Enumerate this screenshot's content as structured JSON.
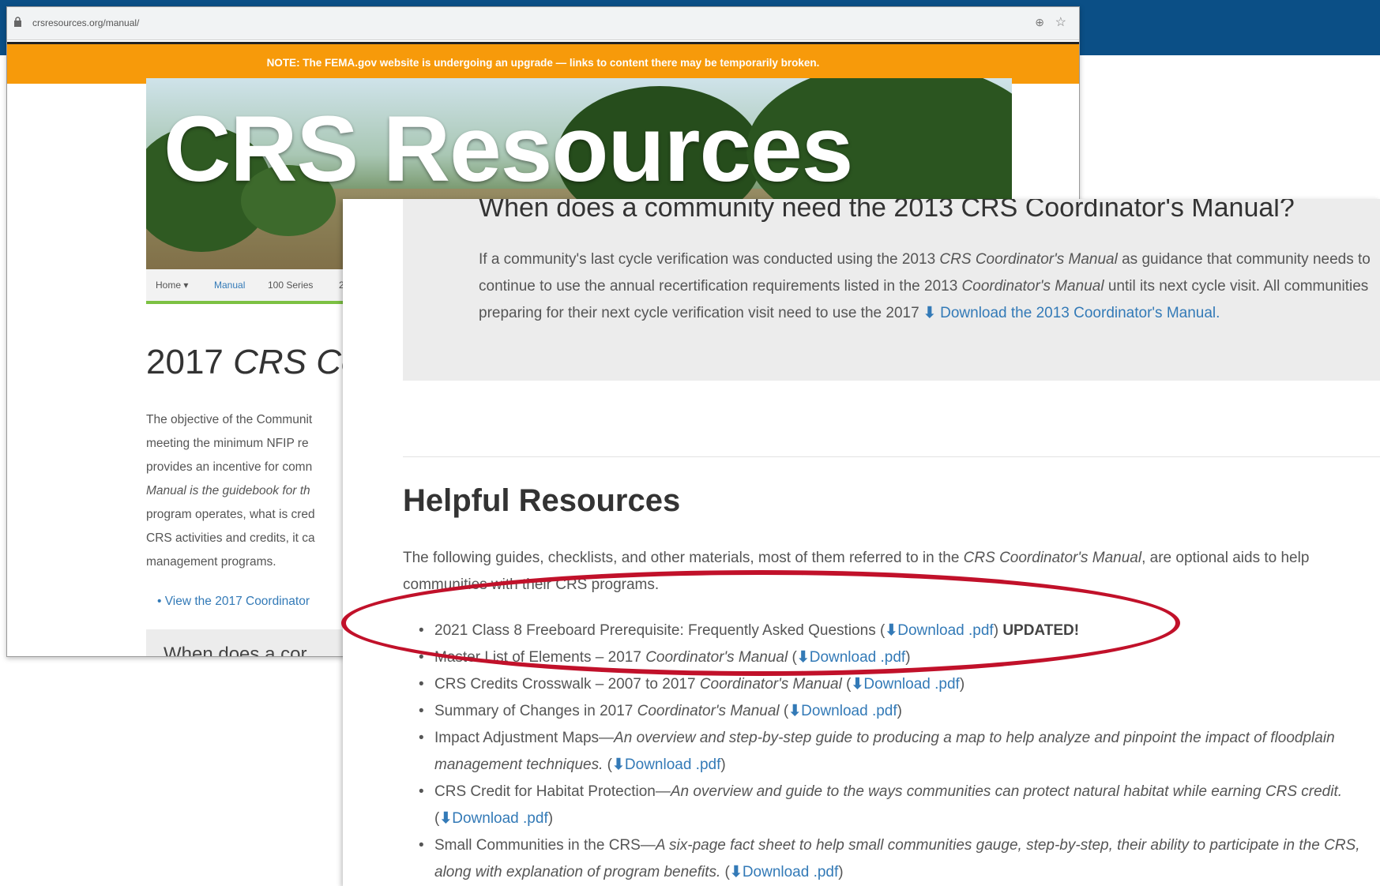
{
  "browser": {
    "url": "crsresources.org/manual/"
  },
  "notice": "NOTE: The FEMA.gov website is undergoing an upgrade — links to content there may be temporarily broken.",
  "hero": {
    "title": "CRS Resources"
  },
  "nav": {
    "items": [
      "Home ▾",
      "Manual",
      "100 Series",
      "2"
    ],
    "active": "Manual"
  },
  "main": {
    "heading_prefix": "2017 ",
    "heading_italic": "CRS Co",
    "paragraph_lines": [
      "The objective of the Communit",
      "meeting the minimum NFIP re",
      "provides an incentive for comn",
      "Manual is the guidebook for th",
      "program operates, what is cred",
      "CRS activities and credits, it ca",
      "management programs."
    ],
    "view_link": "View the 2017 Coordinator",
    "stub_heading": "When does a cor"
  },
  "callout": {
    "heading": "When does a community need the 2013 CRS Coordinator's Manual?",
    "p1": "If a community's last cycle verification was conducted using the 2013 ",
    "p1_italic": "CRS Coordinator's Manual",
    "p2": " as guidance that community needs to continue to use the annual recertification requirements listed in the 2013 ",
    "p2_italic": "Coordinator's Manual",
    "p3": " until its next cycle visit. All communities preparing for their next cycle verification visit need to use the 2017 ",
    "p3_italic": "Coordinator's Manual.",
    "download_link": "Download the 2013 Coordinator's Manual."
  },
  "helpful": {
    "title": "Helpful Resources",
    "intro_a": "The following guides, checklists, and other materials, most of them referred to in the ",
    "intro_italic": "CRS Coordinator's Manual",
    "intro_b": ", are optional aids to help communities with their CRS programs.",
    "download_label": "Download .pdf",
    "updated_label": "UPDATED!",
    "items": [
      {
        "text": "2021 Class 8 Freeboard Prerequisite: Frequently Asked Questions"
      },
      {
        "text": "Master List of Elements – 2017 ",
        "italic": "Coordinator's Manual"
      },
      {
        "text": "CRS Credits Crosswalk – 2007 to 2017 ",
        "italic": "Coordinator's Manual"
      },
      {
        "text": "Summary of Changes in 2017 ",
        "italic": "Coordinator's Manual"
      },
      {
        "text": "Impact Adjustment Maps—",
        "italic": "An overview and step-by-step guide to producing a map to help analyze and pinpoint the impact of floodplain management techniques."
      },
      {
        "text": "CRS Credit for Habitat Protection—",
        "italic": "An overview and guide to the ways communities can protect natural habitat while earning CRS credit."
      },
      {
        "text": "Small Communities in the CRS—",
        "italic": "A six-page fact sheet to help small communities gauge, step-by-step, their ability to participate in the CRS, along with explanation of program benefits."
      }
    ]
  },
  "colors": {
    "notice": "#f79a0a",
    "link": "#337ab7",
    "highlight": "#c1112a",
    "band": "#0b4f86"
  }
}
